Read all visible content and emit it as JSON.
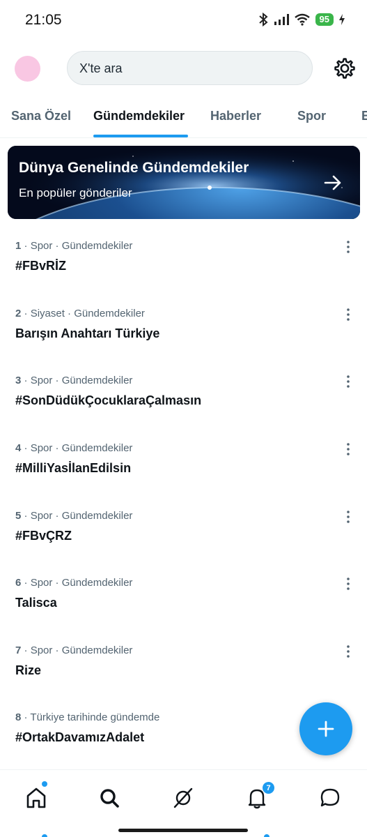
{
  "status_bar": {
    "time": "21:05",
    "battery": "95"
  },
  "search": {
    "placeholder": "X'te ara"
  },
  "tabs": [
    {
      "label": "Sana Özel",
      "active": false
    },
    {
      "label": "Gündemdekiler",
      "active": true
    },
    {
      "label": "Haberler",
      "active": false
    },
    {
      "label": "Spor",
      "active": false
    },
    {
      "label": "E",
      "active": false
    }
  ],
  "banner": {
    "title": "Dünya Genelinde Gündemdekiler",
    "subtitle": "En popüler gönderiler"
  },
  "trends": [
    {
      "rank": "1",
      "category": "Spor · Gündemdekiler",
      "name": "#FBvRİZ"
    },
    {
      "rank": "2",
      "category": "Siyaset · Gündemdekiler",
      "name": "Barışın Anahtarı Türkiye"
    },
    {
      "rank": "3",
      "category": "Spor · Gündemdekiler",
      "name": "#SonDüdükÇocuklaraÇalmasın"
    },
    {
      "rank": "4",
      "category": "Spor · Gündemdekiler",
      "name": "#MilliYasİlanEdilsin"
    },
    {
      "rank": "5",
      "category": "Spor · Gündemdekiler",
      "name": "#FBvÇRZ"
    },
    {
      "rank": "6",
      "category": "Spor · Gündemdekiler",
      "name": "Talisca"
    },
    {
      "rank": "7",
      "category": "Spor · Gündemdekiler",
      "name": "Rize"
    },
    {
      "rank": "8",
      "category": "Türkiye tarihinde gündemde",
      "name": "#OrtakDavamızAdalet"
    }
  ],
  "bottom_nav": {
    "items": [
      "home-icon",
      "search-icon",
      "grok-icon",
      "notifications-icon",
      "messages-icon"
    ],
    "notification_count": "7"
  },
  "colors": {
    "accent": "#1d9bf0",
    "avatar": "#f9c7e3",
    "battery": "#3ab54a"
  }
}
